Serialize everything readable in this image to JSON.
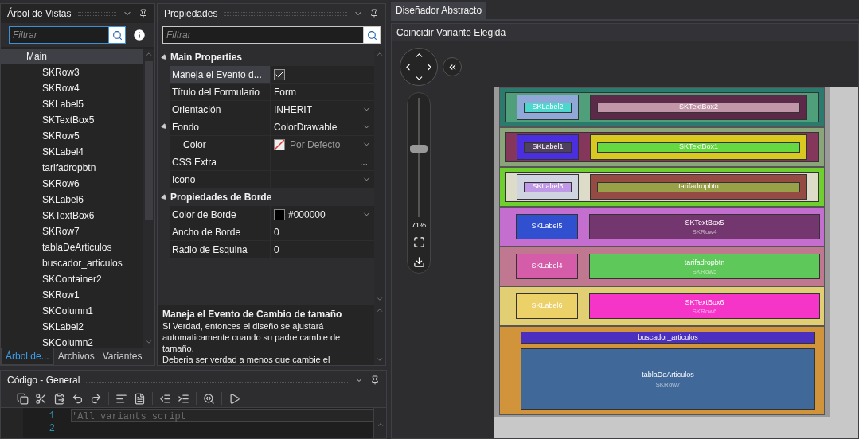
{
  "tree_panel": {
    "title": "Árbol de Vistas",
    "filter": {
      "placeholder": "Filtrar"
    },
    "tree": [
      {
        "label": "Main",
        "selected": true,
        "children": [
          {
            "label": "SKRow3",
            "selected": false
          },
          {
            "label": "SKRow4",
            "selected": false
          },
          {
            "label": "SKLabel5",
            "selected": false
          },
          {
            "label": "SKTextBox5",
            "selected": false
          },
          {
            "label": "SKRow5",
            "selected": false
          },
          {
            "label": "SKLabel4",
            "selected": false
          },
          {
            "label": "tarifadropbtn",
            "selected": false
          },
          {
            "label": "SKRow6",
            "selected": false
          },
          {
            "label": "SKLabel6",
            "selected": false
          },
          {
            "label": "SKTextBox6",
            "selected": false
          },
          {
            "label": "SKRow7",
            "selected": false
          },
          {
            "label": "tablaDeArticulos",
            "selected": false
          },
          {
            "label": "buscador_articulos",
            "selected": false
          },
          {
            "label": "SKContainer2",
            "selected": false
          },
          {
            "label": "SKRow1",
            "selected": false
          },
          {
            "label": "SKColumn1",
            "selected": false
          },
          {
            "label": "SKLabel2",
            "selected": false
          },
          {
            "label": "SKColumn2",
            "selected": false
          }
        ]
      }
    ],
    "tabs": [
      {
        "label": "Árbol de...",
        "selected": true
      },
      {
        "label": "Archivos",
        "selected": false
      },
      {
        "label": "Variantes",
        "selected": false
      }
    ]
  },
  "properties_panel": {
    "title": "Propiedades",
    "filter": {
      "placeholder": "Filtrar"
    },
    "categories": [
      {
        "name": "Main Properties",
        "expanded": true,
        "rows": [
          {
            "name": "Maneja el Evento d...",
            "kind": "check",
            "checked": true,
            "selected": true
          },
          {
            "name": "Título del Formulario",
            "kind": "text",
            "value": "Form",
            "selected": false
          },
          {
            "name": "Orientación",
            "kind": "dropdown",
            "value": "INHERIT",
            "selected": false
          },
          {
            "name": "Fondo",
            "kind": "dropdown",
            "value": "ColorDrawable",
            "selected": false,
            "expanded": true,
            "children": [
              {
                "name": "Color",
                "kind": "color",
                "value": "Por Defecto",
                "selected": false
              }
            ]
          },
          {
            "name": "CSS Extra",
            "kind": "ellipsis",
            "value": "...",
            "selected": false
          },
          {
            "name": "Icono",
            "kind": "dropdown",
            "selected": false
          }
        ]
      },
      {
        "name": "Propiedades de Borde",
        "expanded": true,
        "rows": [
          {
            "name": "Color de Borde",
            "kind": "swatch",
            "value": "#000000",
            "color": "#000000",
            "selected": false
          },
          {
            "name": "Ancho de Borde",
            "kind": "text",
            "value": "0",
            "selected": false
          },
          {
            "name": "Radio de Esquina",
            "kind": "text",
            "value": "0",
            "selected": false
          }
        ]
      }
    ],
    "description": {
      "title": "Maneja el Evento de Cambio de tamaño",
      "text": "Si Verdad, entonces el diseño se ajustará automaticamente cuando su padre cambie de tamaño.",
      "text_2": "Deberia ser verdad a menos que cambie el"
    }
  },
  "code_panel": {
    "title": "Código - General",
    "lines": [
      {
        "number": "1",
        "text": "'All variants script"
      },
      {
        "number": "2"
      }
    ]
  },
  "designer": {
    "tab": "Diseñador Abstracto",
    "toolbar": "Coincidir Variante Elegida",
    "zoom": {
      "level": 0.58,
      "reading": "71%"
    },
    "rows": [
      {
        "kind": "pair",
        "color": "#2a7a6e",
        "container": {
          "color": "#4fa07a"
        },
        "items": [
          {
            "text": "SKLabel2",
            "color": "#8fa8d8",
            "field": {
              "color": "#4cd6cc"
            }
          },
          {
            "text": "SKTextBox2",
            "color": "#5c2a48",
            "field": {
              "color": "#c096a8"
            }
          }
        ]
      },
      {
        "kind": "pair",
        "color": "#8aa57a",
        "container": {
          "color": "#84375a"
        },
        "items": [
          {
            "text": "SKLabel1",
            "color": "#4a2ee0",
            "field": {
              "color": "#504060"
            }
          },
          {
            "text": "SKTextBox1",
            "color": "#d8c820",
            "field": {
              "color": "#66d840"
            }
          }
        ]
      },
      {
        "kind": "pair",
        "color": "#6fcf2e",
        "container": {
          "color": "#dcdcc8"
        },
        "items": [
          {
            "text": "SKLabel3",
            "color": "#d0d4e0",
            "field": {
              "color": "#c098e8"
            }
          },
          {
            "text": "tarifadropbtn",
            "color": "#964a44",
            "field": {
              "color": "#98a048"
            }
          }
        ]
      },
      {
        "kind": "pair",
        "color": "#c46ecf",
        "label": "SKRow4",
        "items": [
          {
            "text": "SKLabel5",
            "color": "#3050d0"
          },
          {
            "text": "SKTextBox5",
            "color": "#73366e"
          }
        ]
      },
      {
        "kind": "pair",
        "color": "#c07890",
        "label": "SKRow5",
        "items": [
          {
            "text": "SKLabel4",
            "color": "#d45ca8"
          },
          {
            "text": "tarifadropbtn",
            "color": "#5ec85a"
          }
        ]
      },
      {
        "kind": "pair",
        "color": "#e3cf73",
        "label": "SKRow6",
        "items": [
          {
            "text": "SKLabel6",
            "color": "#ecd068"
          },
          {
            "text": "SKTextBox6",
            "color": "#f535c8"
          }
        ]
      },
      {
        "kind": "stack",
        "color": "#d1943a",
        "label": "SKRow7",
        "items": [
          {
            "text": "buscador_articulos",
            "color": "#4b30c0"
          },
          {
            "text": "tablaDeArticulos",
            "color": "#406898"
          }
        ]
      }
    ]
  }
}
